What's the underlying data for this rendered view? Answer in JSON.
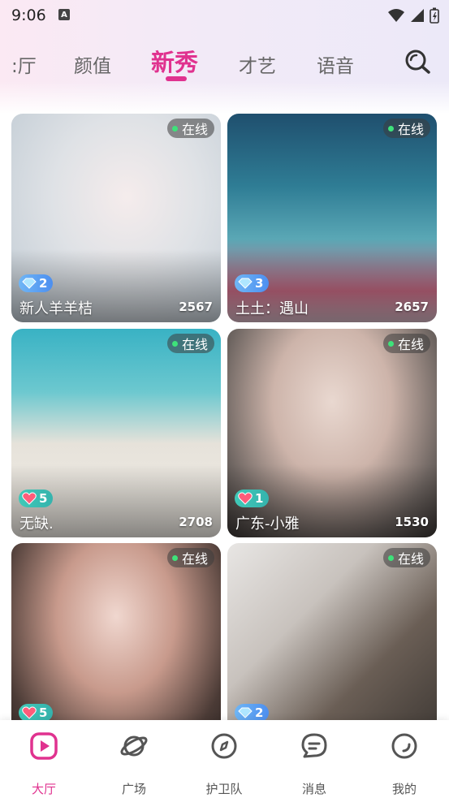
{
  "status_bar": {
    "time": "9:06",
    "notification_icon": "A"
  },
  "tabs": [
    {
      "label": ":厅",
      "active": false
    },
    {
      "label": "颜值",
      "active": false
    },
    {
      "label": "新秀",
      "active": true
    },
    {
      "label": "才艺",
      "active": false
    },
    {
      "label": "语音",
      "active": false
    }
  ],
  "cards": [
    {
      "status": "在线",
      "badge_type": "diamond",
      "level": "2",
      "name": "新人羊羊桔",
      "count": "2567"
    },
    {
      "status": "在线",
      "badge_type": "diamond",
      "level": "3",
      "name": "土土：遇山",
      "count": "2657"
    },
    {
      "status": "在线",
      "badge_type": "heart",
      "level": "5",
      "name": "无缺.",
      "count": "2708"
    },
    {
      "status": "在线",
      "badge_type": "heart",
      "level": "1",
      "name": "广东-小雅",
      "count": "1530"
    },
    {
      "status": "在线",
      "badge_type": "heart",
      "level": "5",
      "name": "",
      "count": ""
    },
    {
      "status": "在线",
      "badge_type": "diamond",
      "level": "2",
      "name": "",
      "count": ""
    }
  ],
  "bottom_nav": [
    {
      "label": "大厅",
      "icon": "play-icon",
      "active": true
    },
    {
      "label": "广场",
      "icon": "planet-icon",
      "active": false
    },
    {
      "label": "护卫队",
      "icon": "compass-icon",
      "active": false
    },
    {
      "label": "消息",
      "icon": "message-icon",
      "active": false
    },
    {
      "label": "我的",
      "icon": "profile-icon",
      "active": false
    }
  ],
  "colors": {
    "accent": "#e0328f",
    "online_dot": "#3ee27a"
  }
}
